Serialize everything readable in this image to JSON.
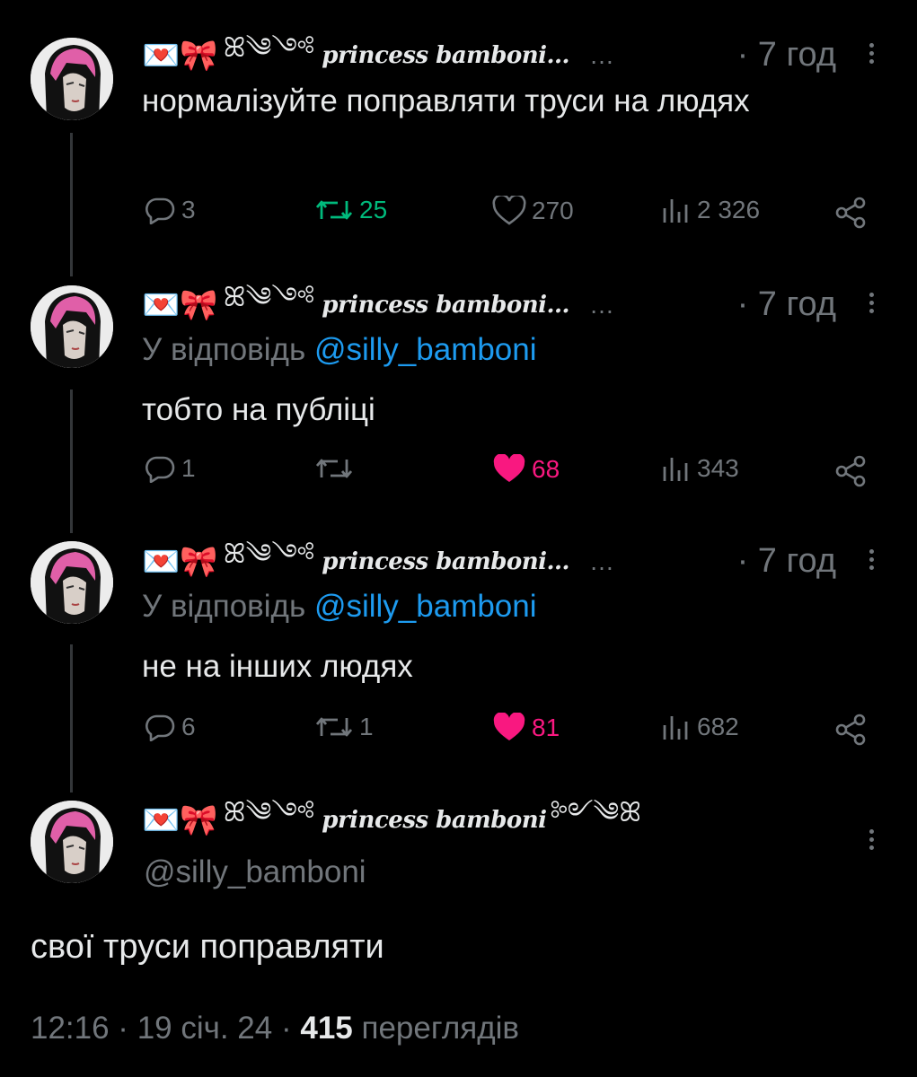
{
  "author": {
    "emoji": "💌🎀",
    "flourish_left": "ꕤ༄༺",
    "display_name": "princess bamboni",
    "truncated_name": "princess bamboni…",
    "name_ellipsis": "…",
    "flourish_right": "༻༄ꕤ",
    "handle": "@silly_bamboni"
  },
  "reply_prefix": "У відповідь",
  "tweets": [
    {
      "time": "· 7 год",
      "reply_to": "",
      "text": "нормалізуйте поправляти труси на людях",
      "replies": "3",
      "retweets": "25",
      "likes": "270",
      "views": "2 326"
    },
    {
      "time": "· 7 год",
      "reply_to": "@silly_bamboni",
      "text": "тобто на публіці",
      "replies": "1",
      "retweets": "",
      "likes": "68",
      "views": "343"
    },
    {
      "time": "· 7 год",
      "reply_to": "@silly_bamboni",
      "text": "не на інших людях",
      "replies": "6",
      "retweets": "1",
      "likes": "81",
      "views": "682"
    }
  ],
  "main_tweet": {
    "text": "свої труси поправляти",
    "time": "12:16 · 19 січ. 24 ·",
    "views_count": "415",
    "views_label": "переглядів"
  },
  "colors": {
    "background": "#000000",
    "text": "#e7e9ea",
    "muted": "#71767b",
    "link": "#1d9bf0",
    "retweet_active": "#00ba7c",
    "like_active": "#f91880",
    "avatar_hair": "#e05fa8"
  },
  "icons": {
    "reply": "reply-icon",
    "retweet": "retweet-icon",
    "like": "heart-icon",
    "views": "views-icon",
    "share": "share-icon",
    "more": "more-icon"
  }
}
